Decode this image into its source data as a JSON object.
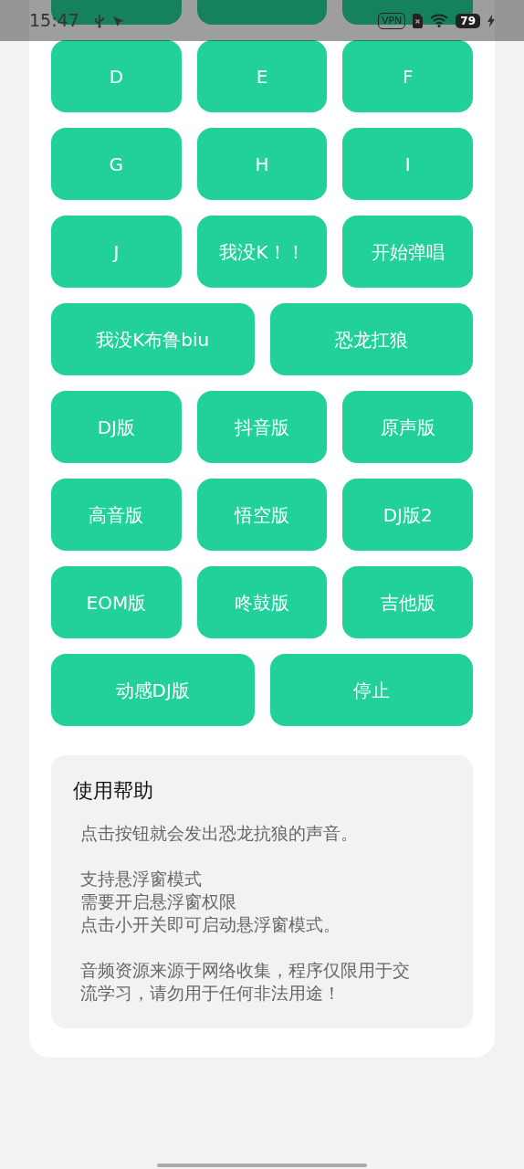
{
  "status_bar": {
    "time": "15:47",
    "vpn": "VPN",
    "battery": "79"
  },
  "button_rows": [
    [
      "D",
      "E",
      "F"
    ],
    [
      "G",
      "H",
      "I"
    ],
    [
      "J",
      "我没K！！",
      "开始弹唱"
    ],
    [
      "我没K布鲁biu",
      "恐龙扛狼"
    ],
    [
      "DJ版",
      "抖音版",
      "原声版"
    ],
    [
      "高音版",
      "悟空版",
      "DJ版2"
    ],
    [
      "EOM版",
      "咚鼓版",
      "吉他版"
    ],
    [
      "动感DJ版",
      "停止"
    ]
  ],
  "help": {
    "title": "使用帮助",
    "paragraphs": [
      [
        "点击按钮就会发出恐龙抗狼的声音。"
      ],
      [
        "支持悬浮窗模式",
        "需要开启悬浮窗权限",
        "点击小开关即可启动悬浮窗模式。"
      ],
      [
        "音频资源来源于网络收集，程序仅限用于交流学习，请勿用于任何非法用途！"
      ]
    ]
  }
}
